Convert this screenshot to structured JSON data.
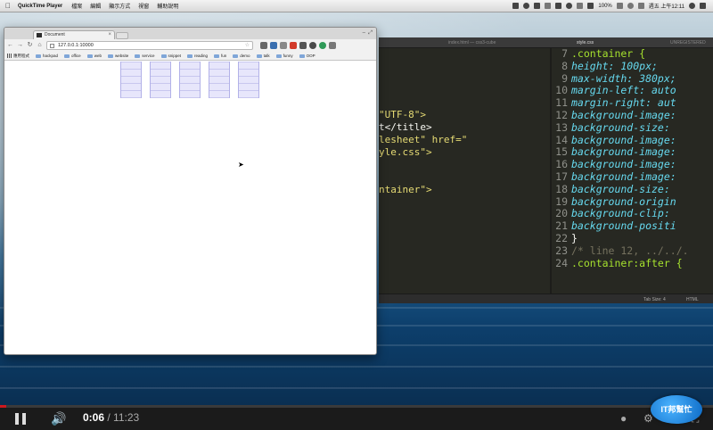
{
  "menubar": {
    "app_name": "QuickTime Player",
    "menus": [
      "檔案",
      "編輯",
      "顯示方式",
      "視窗",
      "輔助說明"
    ],
    "battery": "100%",
    "clock": "週五 上午12:11"
  },
  "browser": {
    "tab_title": "Document",
    "url": "127.0.0.1:10000",
    "bookmarks": [
      "應用程式",
      "hackpad",
      "office",
      "web",
      "website",
      "service",
      "snippet",
      "reading",
      "fun",
      "demo",
      "talk",
      "funny",
      "OOP"
    ]
  },
  "editor": {
    "tabs": {
      "left": "index.html — css3-cube",
      "right": "style.css",
      "window_title": "UNREGISTERED"
    },
    "left_pane_fragments": [
      "\"UTF-8\">",
      "t</title>",
      "lesheet\" href=\"",
      "yle.css\">",
      "ntainer\">"
    ],
    "css_lines": [
      {
        "n": "7",
        "text": ".container {"
      },
      {
        "n": "8",
        "text": "height: 100px;"
      },
      {
        "n": "9",
        "text": "max-width: 380px;"
      },
      {
        "n": "10",
        "text": "margin-left: auto"
      },
      {
        "n": "11",
        "text": "margin-right: aut"
      },
      {
        "n": "12",
        "text": "background-image:"
      },
      {
        "n": "13",
        "text": "background-size:"
      },
      {
        "n": "14",
        "text": "background-image:"
      },
      {
        "n": "15",
        "text": "background-image:"
      },
      {
        "n": "16",
        "text": "background-image:"
      },
      {
        "n": "17",
        "text": "background-image:"
      },
      {
        "n": "18",
        "text": "background-size:"
      },
      {
        "n": "19",
        "text": "background-origin"
      },
      {
        "n": "20",
        "text": "background-clip:"
      },
      {
        "n": "21",
        "text": "background-positi"
      },
      {
        "n": "22",
        "text": "}"
      },
      {
        "n": "23",
        "text": "/* line 12, ../../."
      },
      {
        "n": "24",
        "text": ".container:after {"
      }
    ],
    "status": {
      "tab_size": "Tab Size: 4",
      "syntax": "HTML"
    }
  },
  "video": {
    "current_time": "0:06",
    "duration": "11:23",
    "progress": 0.009
  },
  "watermark": "IT邦幫忙"
}
